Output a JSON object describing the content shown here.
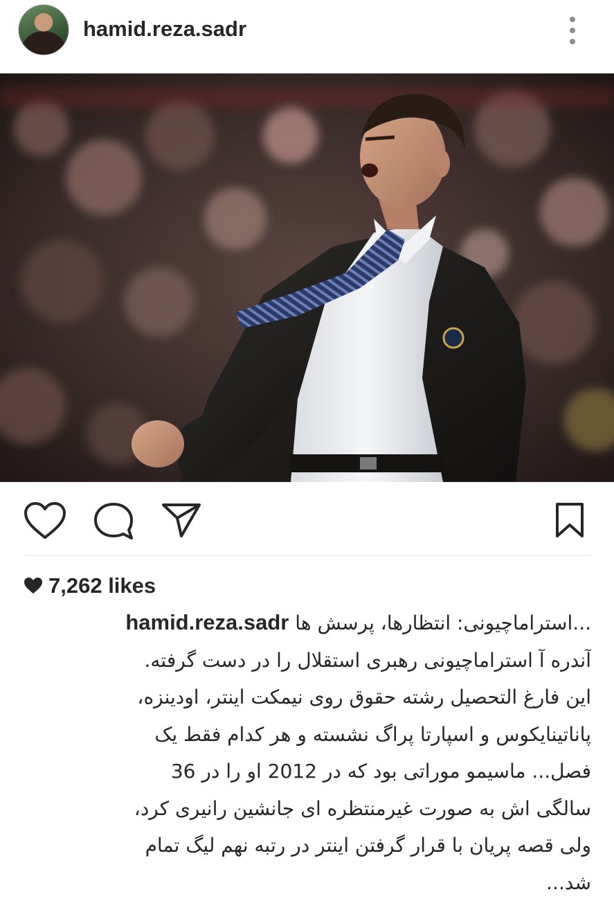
{
  "post": {
    "username": "hamid.reza.sadr",
    "likes_count": "7,262 likes",
    "caption_lines": [
      "...استراماچیونی: انتظارها، پرسش ها",
      "آندره آ استراماچیونی رهبری استقلال را در دست گرفته.",
      "این فارغ التحصیل رشته حقوق روی نیمکت اینتر، اودینزه،",
      "پاناتینایکوس و اسپارتا پراگ نشسته و هر کدام فقط یک",
      "فصل... ماسیمو موراتی بود که در 2012 او را در 36",
      "سالگی اش به صورت غیرمنتظره ای جانشین رانیری کرد،",
      "ولی قصه پریان با قرار گرفتن اینتر در رتبه نهم لیگ تمام",
      "شد..."
    ]
  },
  "icons": {
    "more": "more-vertical-icon",
    "like": "heart-icon",
    "comment": "comment-bubble-icon",
    "share": "paper-plane-icon",
    "save": "bookmark-icon"
  },
  "colors": {
    "text": "#262626",
    "icon": "#262626",
    "divider": "#e6e6e6"
  }
}
